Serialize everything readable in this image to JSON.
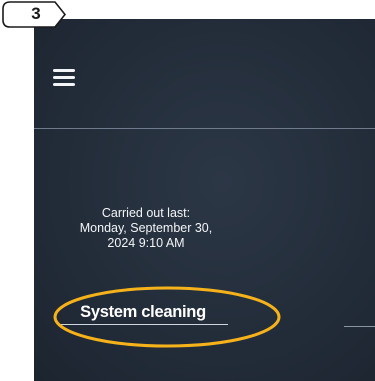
{
  "step_badge": {
    "number": "3",
    "color": "#1a1a1a",
    "background": "#ffffff"
  },
  "screen": {
    "background": "#232d3a",
    "menu_icon": "hamburger-menu-icon",
    "last_run": {
      "line1": "Carried out last:",
      "line2": "Monday, September 30,",
      "line3": "2024 9:10 AM"
    },
    "system_cleaning_label": "System cleaning"
  },
  "highlight": {
    "shape": "ellipse",
    "color": "#f5b21a",
    "target": "system-cleaning-button"
  }
}
